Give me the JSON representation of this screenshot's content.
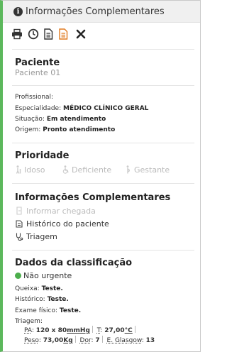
{
  "header": {
    "title": "Informações Complementares"
  },
  "toolbar": {
    "icons": [
      "print-icon",
      "clock-icon",
      "document-icon",
      "report-icon",
      "close-icon"
    ]
  },
  "patient": {
    "heading": "Paciente",
    "name": "Paciente 01"
  },
  "details": {
    "profissional_label": "Profissional:",
    "especialidade_label": "Especialidade:",
    "especialidade_value": "MÉDICO CLÍNICO GERAL",
    "situacao_label": "Situação:",
    "situacao_value": "Em atendimento",
    "origem_label": "Origem:",
    "origem_value": "Pronto atendimento"
  },
  "priority": {
    "heading": "Prioridade",
    "items": [
      "Idoso",
      "Deficiente",
      "Gestante"
    ]
  },
  "complementares": {
    "heading": "Informações Complementares",
    "actions": [
      {
        "label": "Informar chegada",
        "enabled": false
      },
      {
        "label": "Histórico do paciente",
        "enabled": true
      },
      {
        "label": "Triagem",
        "enabled": true
      }
    ]
  },
  "classificacao": {
    "heading": "Dados da classificação",
    "risk_label": "Não urgente",
    "risk_color": "#4cae4c",
    "queixa_label": "Queixa:",
    "queixa_value": "Teste.",
    "historico_label": "Histórico:",
    "historico_value": "Teste.",
    "exame_label": "Exame físico:",
    "exame_value": "Teste.",
    "triagem_label": "Triagem:",
    "vitals": {
      "pa_label": "PA",
      "pa_value": "120 x 80",
      "pa_unit": "mmHg",
      "t_label": "T",
      "t_value": "27,00",
      "t_unit": "°C",
      "peso_label": "Peso",
      "peso_value": "73,00",
      "peso_unit": "Kg",
      "dor_label": "Dor",
      "dor_value": "7",
      "glasgow_label": "E. Glasgow",
      "glasgow_value": "13"
    }
  },
  "colors": {
    "accent": "#5cb85c",
    "header_bg": "#f0f0f0",
    "report_icon": "#e07a1f"
  }
}
